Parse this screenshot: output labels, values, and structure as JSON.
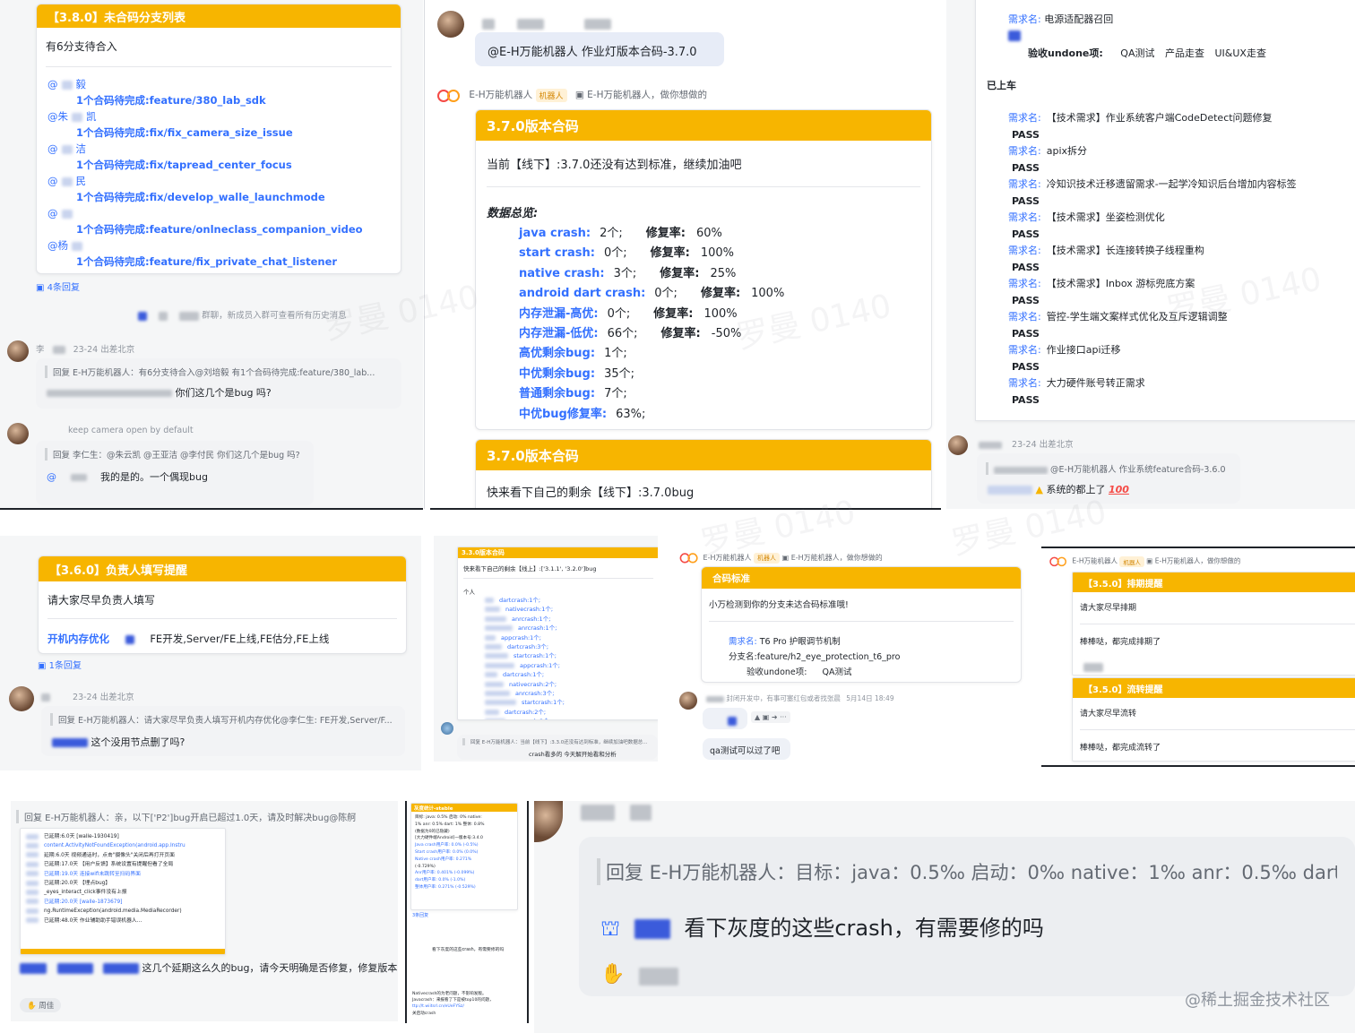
{
  "p1": {
    "card_title": "【3.8.0】未合码分支列表",
    "subtitle": "有6分支待合入",
    "entries": [
      {
        "mention": "@",
        "name": "毅",
        "text": "1个合码待完成:feature/380_lab_sdk"
      },
      {
        "mention": "@朱",
        "name": "凯",
        "text": "1个合码待完成:fix/fix_camera_size_issue"
      },
      {
        "mention": "@",
        "name": "洁",
        "text": "1个合码待完成:fix/tapread_center_focus"
      },
      {
        "mention": "@",
        "name": "民",
        "text": "1个合码待完成:fix/develop_walle_launchmode"
      },
      {
        "mention": "@",
        "name": "",
        "text": "1个合码待完成:feature/onlneclass_companion_video"
      },
      {
        "mention": "@杨",
        "name": "",
        "text": "1个合码待完成:feature/fix_private_chat_listener"
      }
    ],
    "replies": "4条回复",
    "system_msg": "群聊，新成员入群可查看所有历史消息",
    "msg1_name": "李",
    "msg1_status": "23-24 出差北京",
    "msg1_quote": "回复 E-H万能机器人：有6分支待合入@刘培毅    有1个合码待完成:feature/380_lab...",
    "msg1_text": "你们这几个是bug 吗?",
    "msg2_status": "keep camera open by default",
    "msg2_quote": "回复 李仁生：@朱云凯 @王亚洁 @李付民 你们这几个是bug 吗?",
    "msg2_mention": "@",
    "msg2_text": "我的是的。一个偶现bug"
  },
  "p2": {
    "top_bubble": "@E-H万能机器人 作业灯版本合码-3.7.0",
    "bot_name": "E-H万能机器人",
    "bot_tag": "机器人",
    "bot_reply": "E-H万能机器人，做你想做的",
    "card_title": "3.7.0版本合码",
    "status_line": "当前【线下】:3.7.0还没有达到标准，继续加油吧",
    "overview_title": "数据总览:",
    "stats": [
      {
        "label": "java crash:",
        "count": "2个;",
        "rate_label": "修复率:",
        "rate": "60%"
      },
      {
        "label": "start crash:",
        "count": "0个;",
        "rate_label": "修复率:",
        "rate": "100%"
      },
      {
        "label": "native crash:",
        "count": "3个;",
        "rate_label": "修复率:",
        "rate": "25%"
      },
      {
        "label": "android dart crash:",
        "count": "0个;",
        "rate_label": "修复率:",
        "rate": "100%"
      },
      {
        "label": "内存泄漏-高优:",
        "count": "0个;",
        "rate_label": "修复率:",
        "rate": "100%"
      },
      {
        "label": "内存泄漏-低优:",
        "count": "66个;",
        "rate_label": "修复率:",
        "rate": "-50%"
      },
      {
        "label": "高优剩余bug:",
        "count": "1个;",
        "rate_label": "",
        "rate": ""
      },
      {
        "label": "中优剩余bug:",
        "count": "35个;",
        "rate_label": "",
        "rate": ""
      },
      {
        "label": "普通剩余bug:",
        "count": "7个;",
        "rate_label": "",
        "rate": ""
      },
      {
        "label": "中优bug修复率:",
        "count": "63%;",
        "rate_label": "",
        "rate": ""
      }
    ],
    "card2_title": "3.7.0版本合码",
    "card2_text": "快来看下自己的剩余【线下】:3.7.0bug"
  },
  "p3": {
    "head_label": "需求名:",
    "head_value": "电源适配器召回",
    "accept_label": "验收undone项:",
    "accept_items": [
      "QA测试",
      "产品走查",
      "UI&UX走查"
    ],
    "section": "已上车",
    "reqs": [
      {
        "label": "需求名:",
        "name": "【技术需求】作业系统客户端CodeDetect问题修复",
        "status": "PASS"
      },
      {
        "label": "需求名:",
        "name": "apix拆分",
        "status": "PASS"
      },
      {
        "label": "需求名:",
        "name": "冷知识技术迁移遗留需求-一起学冷知识后台增加内容标签",
        "status": "PASS"
      },
      {
        "label": "需求名:",
        "name": "【技术需求】坐姿检测优化",
        "status": "PASS"
      },
      {
        "label": "需求名:",
        "name": "【技术需求】长连接转换子线程重构",
        "status": "PASS"
      },
      {
        "label": "需求名:",
        "name": "【技术需求】Inbox 游标兜底方案",
        "status": "PASS"
      },
      {
        "label": "需求名:",
        "name": "管控-学生端文案样式优化及互斥逻辑调整",
        "status": "PASS"
      },
      {
        "label": "需求名:",
        "name": "作业接口api迁移",
        "status": "PASS"
      },
      {
        "label": "需求名:",
        "name": "大力硬件账号转正需求",
        "status": "PASS"
      }
    ],
    "msg_status": "23-24 出差北京",
    "msg_quote": "@E-H万能机器人 作业系统feature合码-3.6.0",
    "msg_text": "系统的都上了",
    "msg_emoji": "100"
  },
  "p4": {
    "card_title": "【3.6.0】负责人填写提醒",
    "body": "请大家尽早负责人填写",
    "item_label": "开机内存优化",
    "item_tail": "FE开发,Server/FE上线,FE估分,FE上线",
    "replies": "1条回复",
    "msg_status": "23-24 出差北京",
    "msg_quote": "回复 E-H万能机器人：请大家尽早负责人填写开机内存优化@李仁生: FE开发,Server/F...",
    "msg_text": "这个没用节点删了吗?"
  },
  "p5": {
    "header": "3.3.0版本合码",
    "line1": "快来看下自己的剩余【线上】:['3.1.1', '3.2.0']bug",
    "person_label": "个人",
    "rows": [
      "dartcrash:1个;",
      "nativecrash:1个;",
      "anrcrash:1个;",
      "anrcrash:1个;",
      "appcrash:1个;",
      "dartcrash:3个;",
      "startcrash:1个;",
      "appcrash:1个;",
      "dartcrash:1个;",
      "nativecrash:2个;",
      "anrcrash:3个;",
      "startcrash:1个;",
      "dartcrash:2个;",
      "appcrash:2个;",
      "startcrash:1个;"
    ],
    "quote": "回复 E-H万能机器人：当前【线下】:3.3.0还没有达到标准，继续加油吧数据总...",
    "reply": "crash看多的 今天解开始看和分析"
  },
  "p6": {
    "bot_name": "E-H万能机器人",
    "bot_tag": "机器人",
    "bot_reply": "E-H万能机器人，做你想做的",
    "card_title": "合码标准",
    "body": "小万检测到你的分支未达合码标准哦!",
    "req_label": "需求名:",
    "req_value": "T6 Pro 护眼调节机制",
    "branch_label": "分支名:",
    "branch_value": "feature/h2_eye_protection_t6_pro",
    "accept_label": "验收undone项:",
    "accept_value": "QA测试",
    "msg_status": "封闭开发中，有事可塞红包或者找张晨",
    "msg_time": "5月14日 18:49",
    "msg_text": "qa测试可以过了吧"
  },
  "p7": {
    "bot_name": "E-H万能机器人",
    "bot_tag": "机器人",
    "bot_reply": "E-H万能机器人，做你想做的",
    "card1_title": "【3.5.0】排期提醒",
    "card1_body": "请大家尽早排期",
    "card1_reply": "棒棒哒，都完成排期了",
    "card2_title": "【3.5.0】流转提醒",
    "card2_body": "请大家尽早流转",
    "card2_reply": "棒棒哒，都完成流转了"
  },
  "p8": {
    "quote": "回复 E-H万能机器人：亲，以下['P2']bug开启已超过1.0天，请及时解决bug@陈舸",
    "lines": [
      "已延期:6.0天  [walle-1930419]",
      "content.ActivityNotFoundException(android.app.Instru",
      "延期:6.0天  视频通话时，点击\"摄像头\"关闭后再打开页面",
      "已延期:17.0天  【用户反馈】系统设置有提醒但看了全局",
      "已延期:19.0天  连接wifi未跳转至扫码界面",
      "已延期:20.0天  【埋点bug】",
      "_eyes_interact_click事件没有上报",
      "已延期:20.0天  [walle-1873679]",
      "ng.RuntimeException(android.media.MediaRecorder)",
      "已延期:48.0天  作业辅助助手错误机器人..."
    ],
    "message": "这几个延期这么久的bug，请今天明确是否修复，修复版本",
    "footer": "周佳"
  },
  "p9": {
    "header": "灰度统计-stable",
    "lines": [
      "目标: java: 0.5%  启动: 0%  native:",
      "1%  anr: 0.5%  dart: 1%  整体: 0.8%",
      "(数据为0的已隐藏)",
      "[大力硬件端Android]一版本号:3.4.0",
      "Java crash用户率: 0.0% (-0.5%)",
      "Start crash用户率: 0.0% (0.0%)",
      "Native crash用户率: 0.271%",
      "(-0.729%)",
      "Anr用户率: 0.401% (-0.099%)",
      "dart用户率: 0.0% (-1.0%)",
      "整体用户率: 0.271% (-0.529%)"
    ],
    "replies": "3条回复",
    "msg1": "看下灰度的这些crash，有需要修的吗",
    "msg2": "Nativecrash的为老问题，不影响发版。",
    "msg3": "Javacrash：来报看了下是被top10的问题，",
    "link": "ttp://t.wiitsrl.cn/eUeFYSz/",
    "msg4": "关启动crash"
  },
  "p10": {
    "quote": "回复 E-H万能机器人：目标：java：0.5‰ 启动：0‰ native：1‰ anr：0.5‰ dart：",
    "message": "看下灰度的这些crash，有需要修的吗",
    "watermark": "@稀土掘金技术社区"
  },
  "bg_watermark": "罗曼 0140",
  "colors": {
    "accent": "#f7b500",
    "link": "#3370ff",
    "brand_red": "#f54a45"
  }
}
